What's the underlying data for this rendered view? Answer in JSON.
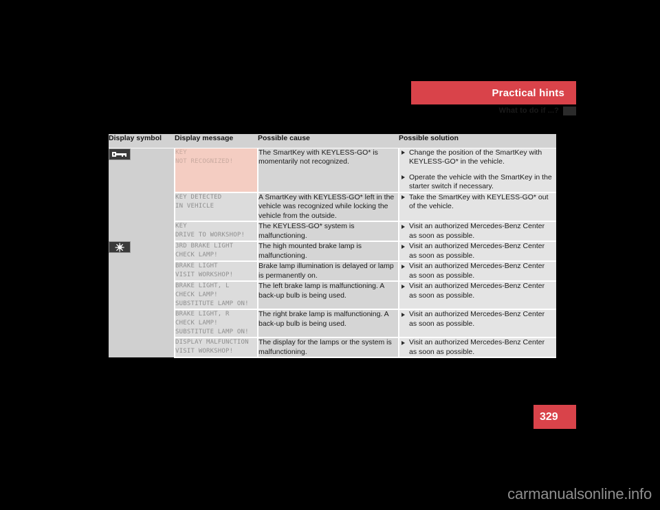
{
  "header": {
    "banner_title": "Practical hints",
    "section_title": "What to do if ...?"
  },
  "table": {
    "columns": [
      "Display symbol",
      "Display message",
      "Possible cause",
      "Possible solution"
    ],
    "rows": [
      {
        "symbol": "key-symbol",
        "message": "KEY\nNOT RECOGNIZED!",
        "message_alert": true,
        "cause": "The SmartKey with KEYLESS-GO* is momentarily not recognized.",
        "solutions": [
          "Change the position of the SmartKey with KEYLESS-GO* in the vehicle.",
          "Operate the vehicle with the SmartKey in the starter switch if necessary."
        ]
      },
      {
        "symbol": "",
        "message": "KEY DETECTED\nIN VEHICLE",
        "message_alert": false,
        "cause": "A SmartKey with KEYLESS-GO* left in the vehicle was recognized while locking the vehicle from the outside.",
        "solutions": [
          "Take the SmartKey with KEYLESS-GO* out of the vehicle."
        ]
      },
      {
        "symbol": "",
        "message": "KEY\nDRIVE TO WORKSHOP!",
        "message_alert": false,
        "cause": "The KEYLESS-GO* system is malfunctioning.",
        "solutions": [
          "Visit an authorized Mercedes-Benz Center as soon as possible."
        ]
      },
      {
        "symbol": "lamp-symbol",
        "message": "3RD BRAKE LIGHT\nCHECK LAMP!",
        "message_alert": false,
        "cause": "The high mounted brake lamp is malfunctioning.",
        "solutions": [
          "Visit an authorized Mercedes-Benz Center as soon as possible."
        ]
      },
      {
        "symbol": "",
        "message": "BRAKE LIGHT\nVISIT WORKSHOP!",
        "message_alert": false,
        "cause": "Brake lamp illumination is delayed or lamp is permanently on.",
        "solutions": [
          "Visit an authorized Mercedes-Benz Center as soon as possible."
        ]
      },
      {
        "symbol": "",
        "message": "BRAKE LIGHT, L\nCHECK LAMP!\nSUBSTITUTE LAMP ON!",
        "message_alert": false,
        "cause": "The left brake lamp is malfunctioning. A back-up bulb is being used.",
        "solutions": [
          "Visit an authorized Mercedes-Benz Center as soon as possible."
        ]
      },
      {
        "symbol": "",
        "message": "BRAKE LIGHT, R\nCHECK LAMP!\nSUBSTITUTE LAMP ON!",
        "message_alert": false,
        "cause": "The right brake lamp is malfunctioning. A back-up bulb is being used.",
        "solutions": [
          "Visit an authorized Mercedes-Benz Center as soon as possible."
        ]
      },
      {
        "symbol": "",
        "message": "DISPLAY MALFUNCTION\nVISIT WORKSHOP!",
        "message_alert": false,
        "cause": "The display for the lamps or the system is malfunctioning.",
        "solutions": [
          "Visit an authorized Mercedes-Benz Center as soon as possible."
        ]
      }
    ]
  },
  "footer": {
    "page_number": "329",
    "watermark": "carmanualsonline.info"
  },
  "colors": {
    "accent_red": "#d9434a",
    "alert_cell": "#f4cdc2",
    "header_row": "#d2d2d2"
  }
}
